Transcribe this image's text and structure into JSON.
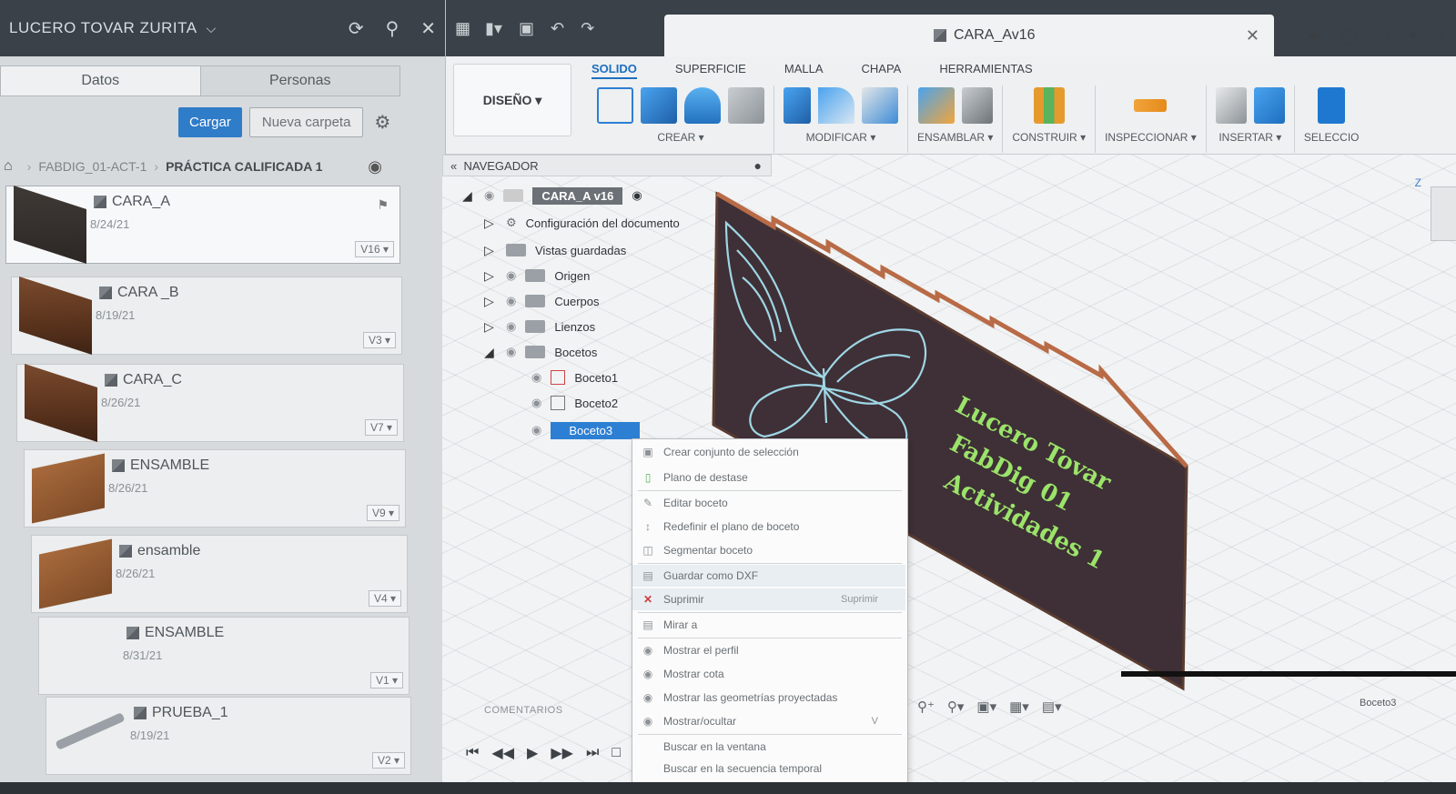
{
  "left_panel": {
    "user_name": "LUCERO TOVAR ZURITA",
    "tabs": [
      {
        "label": "Datos",
        "active": true
      },
      {
        "label": "Personas",
        "active": false
      }
    ],
    "upload_button": "Cargar",
    "new_folder_button": "Nueva carpeta",
    "breadcrumb": {
      "project": "FABDIG_01-ACT-1",
      "folder": "PRÁCTICA CALIFICADA 1"
    },
    "files": [
      {
        "name": "CARA_A",
        "date": "8/24/21",
        "version": "V16",
        "thumb": "dark"
      },
      {
        "name": "CARA _B",
        "date": "8/19/21",
        "version": "V3",
        "thumb": "wood"
      },
      {
        "name": "CARA_C",
        "date": "8/26/21",
        "version": "V7",
        "thumb": "wood"
      },
      {
        "name": "ENSAMBLE",
        "date": "8/26/21",
        "version": "V9",
        "thumb": "box"
      },
      {
        "name": "ensamble",
        "date": "8/26/21",
        "version": "V4",
        "thumb": "box"
      },
      {
        "name": "ENSAMBLE",
        "date": "8/31/21",
        "version": "V1",
        "thumb": "none"
      },
      {
        "name": "PRUEBA_1",
        "date": "8/19/21",
        "version": "V2",
        "thumb": "rod"
      }
    ]
  },
  "document": {
    "title": "CARA_Av16"
  },
  "ribbon": {
    "workspace": "DISEÑO",
    "tabs": [
      "SOLIDO",
      "SUPERFICIE",
      "MALLA",
      "CHAPA",
      "HERRAMIENTAS"
    ],
    "active_tab": "SOLIDO",
    "groups": [
      "CREAR",
      "MODIFICAR",
      "ENSAMBLAR",
      "CONSTRUIR",
      "INSPECCIONAR",
      "INSERTAR",
      "SELECCIO"
    ]
  },
  "navigator": {
    "title": "NAVEGADOR",
    "root": "CARA_A v16",
    "items": [
      "Configuración del documento",
      "Vistas guardadas",
      "Origen",
      "Cuerpos",
      "Lienzos",
      "Bocetos"
    ],
    "sketches": [
      "Boceto1",
      "Boceto2",
      "Boceto3"
    ]
  },
  "context_menu": {
    "items": [
      "Crear conjunto de selección",
      "Plano de destase",
      "Editar boceto",
      "Redefinir el plano de boceto",
      "Segmentar boceto",
      "Guardar como DXF",
      "Suprimir",
      "Mirar a",
      "Mostrar el perfil",
      "Mostrar cota",
      "Mostrar las geometrías proyectadas",
      "Mostrar/ocultar",
      "Buscar en la ventana",
      "Buscar en la secuencia temporal"
    ],
    "suprimir_shortcut": "Suprimir",
    "mostrar_shortcut": "V"
  },
  "model_text": {
    "line1": "Lucero Tovar",
    "line2": "FabDig 01",
    "line3": "Actividades 1"
  },
  "status": {
    "comments_label": "COMENTARIOS",
    "selection": "Boceto3"
  },
  "colors": {
    "accent": "#2f7cc8",
    "panel_wood": "#3f3138",
    "engrave_text": "#9be36a",
    "butterfly": "#9fd6e6"
  }
}
